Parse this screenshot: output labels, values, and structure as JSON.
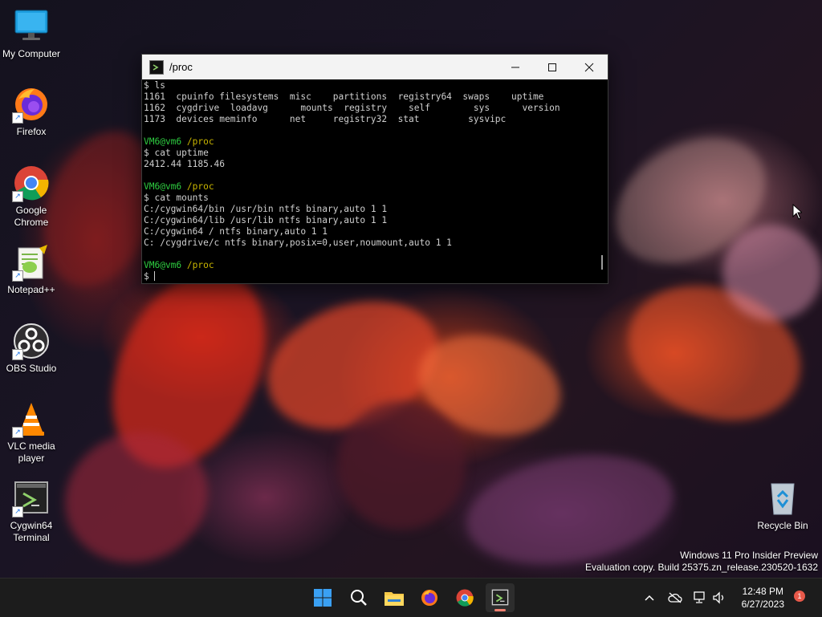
{
  "desktop": {
    "icons": [
      {
        "label": "My Computer",
        "icon": "monitor-icon"
      },
      {
        "label": "Firefox",
        "icon": "firefox-icon"
      },
      {
        "label": "Google Chrome",
        "icon": "chrome-icon"
      },
      {
        "label": "Notepad++",
        "icon": "notepadpp-icon"
      },
      {
        "label": "OBS Studio",
        "icon": "obs-icon"
      },
      {
        "label": "VLC media player",
        "icon": "vlc-icon"
      },
      {
        "label": "Cygwin64 Terminal",
        "icon": "cygwin-terminal-icon"
      }
    ],
    "recycle_bin": {
      "label": "Recycle Bin",
      "icon": "recycle-bin-icon"
    }
  },
  "terminal": {
    "title": "/proc",
    "lines": [
      {
        "type": "cmd",
        "text": "$ ls"
      },
      {
        "type": "out",
        "text": "1161  cpuinfo filesystems  misc    partitions  registry64  swaps    uptime"
      },
      {
        "type": "out",
        "text": "1162  cygdrive  loadavg      mounts  registry    self        sys      version"
      },
      {
        "type": "out",
        "text": "1173  devices meminfo      net     registry32  stat         sysvipc"
      },
      {
        "type": "blank",
        "text": ""
      },
      {
        "type": "prompt",
        "user": "VM6@vm6",
        "path": "/proc"
      },
      {
        "type": "cmd",
        "text": "$ cat uptime"
      },
      {
        "type": "out",
        "text": "2412.44 1185.46"
      },
      {
        "type": "blank",
        "text": ""
      },
      {
        "type": "prompt",
        "user": "VM6@vm6",
        "path": "/proc"
      },
      {
        "type": "cmd",
        "text": "$ cat mounts"
      },
      {
        "type": "out",
        "text": "C:/cygwin64/bin /usr/bin ntfs binary,auto 1 1"
      },
      {
        "type": "out",
        "text": "C:/cygwin64/lib /usr/lib ntfs binary,auto 1 1"
      },
      {
        "type": "out",
        "text": "C:/cygwin64 / ntfs binary,auto 1 1"
      },
      {
        "type": "out",
        "text": "C: /cygdrive/c ntfs binary,posix=0,user,noumount,auto 1 1"
      },
      {
        "type": "blank",
        "text": ""
      },
      {
        "type": "prompt",
        "user": "VM6@vm6",
        "path": "/proc"
      },
      {
        "type": "input",
        "text": "$ "
      }
    ]
  },
  "watermark": {
    "line1": "Windows 11 Pro Insider Preview",
    "line2": "Evaluation copy. Build 25375.zn_release.230520-1632"
  },
  "taskbar": {
    "apps": [
      "windows-start-icon",
      "search-icon",
      "file-explorer-icon",
      "firefox-icon",
      "chrome-icon",
      "cygwin-terminal-icon"
    ],
    "clock": {
      "time": "12:48 PM",
      "date": "6/27/2023"
    },
    "notifications": "1"
  }
}
